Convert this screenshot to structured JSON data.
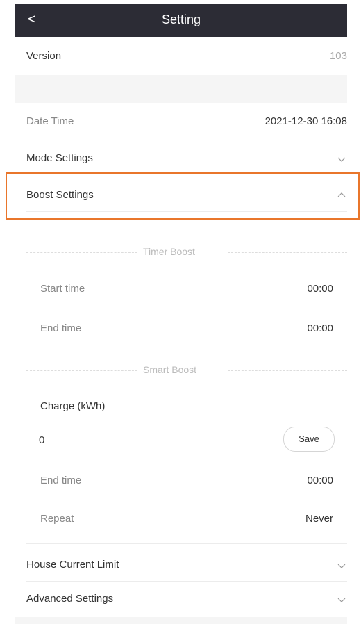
{
  "header": {
    "title": "Setting",
    "back_label": "<"
  },
  "version": {
    "label": "Version",
    "value": "103"
  },
  "date_time": {
    "label": "Date Time",
    "value": "2021-12-30 16:08"
  },
  "mode_settings": {
    "label": "Mode Settings"
  },
  "boost_settings": {
    "label": "Boost Settings"
  },
  "timer_boost": {
    "title": "Timer Boost",
    "start_label": "Start time",
    "start_value": "00:00",
    "end_label": "End time",
    "end_value": "00:00"
  },
  "smart_boost": {
    "title": "Smart Boost",
    "charge_label": "Charge (kWh)",
    "charge_value": "0",
    "save_label": "Save",
    "end_label": "End time",
    "end_value": "00:00",
    "repeat_label": "Repeat",
    "repeat_value": "Never"
  },
  "house_current_limit": {
    "label": "House Current Limit"
  },
  "advanced_settings": {
    "label": "Advanced Settings"
  },
  "colors": {
    "header_bg": "#2c2c35",
    "highlight": "#e9762b"
  },
  "icons": {
    "back": "chevron-left-icon",
    "collapsed": "chevron-down-icon",
    "expanded": "chevron-up-icon"
  }
}
